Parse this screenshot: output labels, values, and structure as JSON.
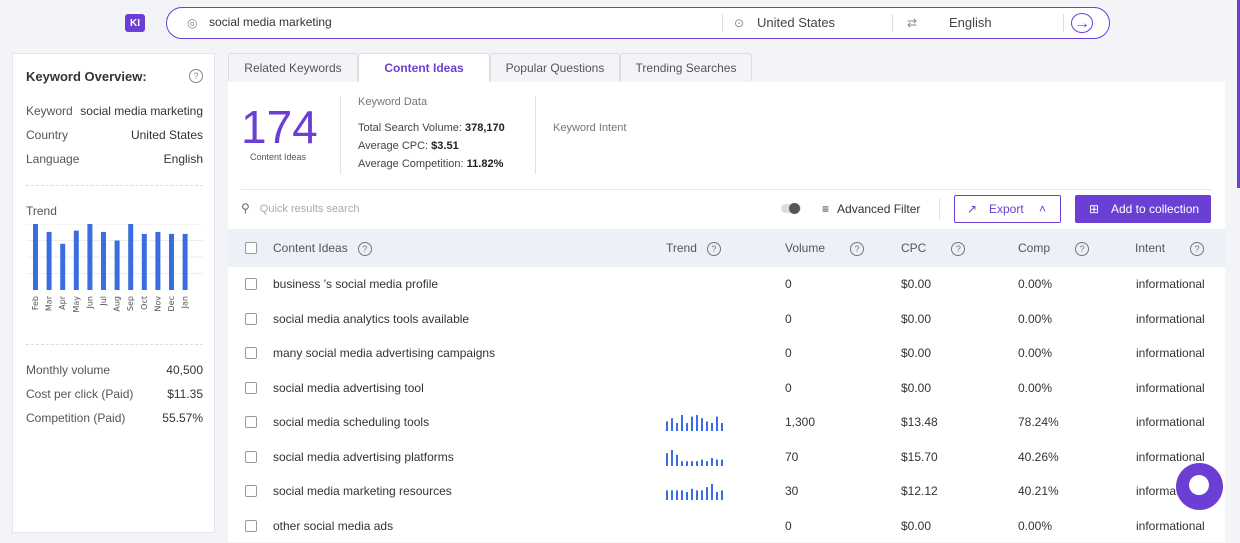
{
  "app": {
    "logo": "KI"
  },
  "search": {
    "query": "social media marketing",
    "country": "United States",
    "language": "English"
  },
  "overview": {
    "title": "Keyword Overview:",
    "rows": [
      {
        "label": "Keyword",
        "value": "social media marketing"
      },
      {
        "label": "Country",
        "value": "United States"
      },
      {
        "label": "Language",
        "value": "English"
      }
    ],
    "trend_label": "Trend",
    "months": [
      "Feb",
      "Mar",
      "Apr",
      "May",
      "Jun",
      "Jul",
      "Aug",
      "Sep",
      "Oct",
      "Nov",
      "Dec",
      "Jan"
    ],
    "trend_values": [
      100,
      88,
      70,
      90,
      100,
      88,
      75,
      100,
      85,
      88,
      85,
      85
    ],
    "stats": [
      {
        "label": "Monthly volume",
        "value": "40,500"
      },
      {
        "label": "Cost per click (Paid)",
        "value": "$11.35"
      },
      {
        "label": "Competition (Paid)",
        "value": "55.57%"
      }
    ]
  },
  "tabs": [
    "Related Keywords",
    "Content Ideas",
    "Popular Questions",
    "Trending Searches"
  ],
  "summary": {
    "count": "174",
    "count_label": "Content Ideas",
    "kd_title": "Keyword Data",
    "total_label": "Total Search Volume:",
    "total": "378,170",
    "cpc_label": "Average CPC:",
    "cpc": "$3.51",
    "comp_label": "Average Competition:",
    "comp": "11.82%",
    "intent_title": "Keyword Intent"
  },
  "toolbar": {
    "search_placeholder": "Quick results search",
    "advanced_filter": "Advanced Filter",
    "export": "Export",
    "add": "Add to collection"
  },
  "table": {
    "headers": {
      "idea": "Content Ideas",
      "trend": "Trend",
      "volume": "Volume",
      "cpc": "CPC",
      "comp": "Comp",
      "intent": "Intent"
    },
    "rows": [
      {
        "idea": "business 's social media profile",
        "volume": "0",
        "cpc": "$0.00",
        "comp": "0.00%",
        "intent": "informational",
        "trend": []
      },
      {
        "idea": "social media analytics tools available",
        "volume": "0",
        "cpc": "$0.00",
        "comp": "0.00%",
        "intent": "informational",
        "trend": []
      },
      {
        "idea": "many social media advertising campaigns",
        "volume": "0",
        "cpc": "$0.00",
        "comp": "0.00%",
        "intent": "informational",
        "trend": []
      },
      {
        "idea": "social media advertising tool",
        "volume": "0",
        "cpc": "$0.00",
        "comp": "0.00%",
        "intent": "informational",
        "trend": []
      },
      {
        "idea": "social media scheduling tools",
        "volume": "1,300",
        "cpc": "$13.48",
        "comp": "78.24%",
        "intent": "informational",
        "trend": [
          60,
          80,
          50,
          100,
          50,
          90,
          100,
          80,
          60,
          50,
          90,
          50
        ]
      },
      {
        "idea": "social media advertising platforms",
        "volume": "70",
        "cpc": "$15.70",
        "comp": "40.26%",
        "intent": "informational",
        "trend": [
          80,
          100,
          70,
          30,
          30,
          30,
          30,
          40,
          30,
          50,
          40,
          40
        ]
      },
      {
        "idea": "social media marketing resources",
        "volume": "30",
        "cpc": "$12.12",
        "comp": "40.21%",
        "intent": "informational",
        "trend": [
          60,
          60,
          60,
          60,
          50,
          70,
          60,
          60,
          80,
          100,
          50,
          60
        ]
      },
      {
        "idea": "other social media ads",
        "volume": "0",
        "cpc": "$0.00",
        "comp": "0.00%",
        "intent": "informational",
        "trend": []
      }
    ]
  },
  "colors": {
    "accent": "#6b3fd4",
    "trend_bar": "#3a6ee0"
  }
}
